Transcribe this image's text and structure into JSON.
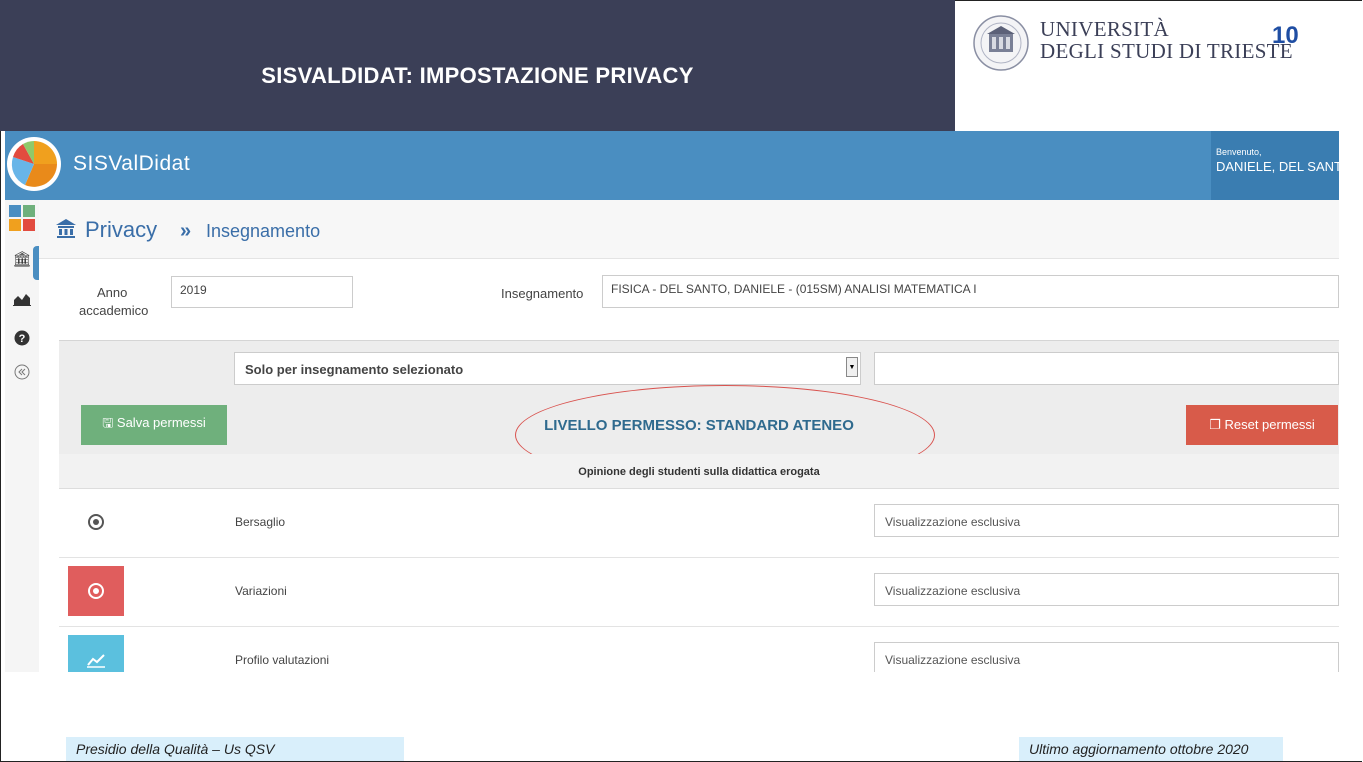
{
  "slide": {
    "title": "SISVALDIDAT: IMPOSTAZIONE PRIVACY",
    "university_line1": "UNIVERSITÀ",
    "university_line2": "DEGLI STUDI DI TRIESTE",
    "page_number": "10",
    "footer_left": "Presidio della Qualità – Us QSV",
    "footer_right": "Ultimo aggiornamento ottobre 2020"
  },
  "app": {
    "brand": "SISValDidat",
    "welcome": "Benvenuto,",
    "user_name": "DANIELE, DEL SANTO",
    "page_title": "Privacy",
    "breadcrumb_sep": "»",
    "page_subtitle": "Insegnamento",
    "anno_label_1": "Anno",
    "anno_label_2": "accademico",
    "anno_value": "2019",
    "insegnamento_label": "Insegnamento",
    "insegnamento_value": "FISICA - DEL SANTO, DANIELE - (015SM) ANALISI MATEMATICA I",
    "filter_value": "Solo per insegnamento selezionato",
    "save_label": "Salva permessi",
    "reset_label": "Reset permessi",
    "level_text": "LIVELLO PERMESSO: STANDARD ATENEO",
    "section_title": "Opinione degli studenti sulla didattica erogata",
    "rows": [
      {
        "label": "Bersaglio",
        "value": "Visualizzazione esclusiva",
        "icon": "target-icon",
        "color": "#ffffff"
      },
      {
        "label": "Variazioni",
        "value": "Visualizzazione esclusiva",
        "icon": "circle-dot-icon",
        "color": "#e05d5d"
      },
      {
        "label": "Profilo valutazioni",
        "value": "Visualizzazione esclusiva",
        "icon": "line-chart-icon",
        "color": "#5bc0de"
      }
    ]
  },
  "colors": {
    "slide_header": "#3b3f57",
    "app_topbar": "#4a8ec1",
    "save_button": "#6fb07c",
    "reset_button": "#d85b4a",
    "footer_box": "#d9effb",
    "annotation": "#d9534f"
  }
}
